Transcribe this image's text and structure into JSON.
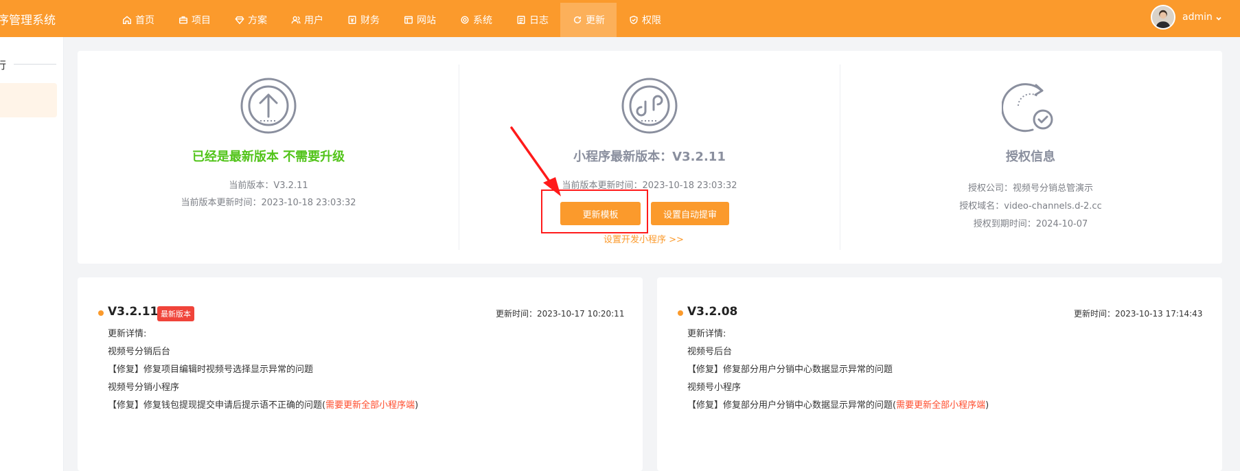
{
  "header": {
    "brand": "序管理系统",
    "nav": [
      {
        "label": "首页",
        "icon": "home-icon"
      },
      {
        "label": "项目",
        "icon": "briefcase-icon"
      },
      {
        "label": "方案",
        "icon": "diamond-icon"
      },
      {
        "label": "用户",
        "icon": "users-icon"
      },
      {
        "label": "财务",
        "icon": "finance-icon"
      },
      {
        "label": "网站",
        "icon": "window-icon"
      },
      {
        "label": "系统",
        "icon": "gear-icon"
      },
      {
        "label": "日志",
        "icon": "log-icon"
      },
      {
        "label": "更新",
        "icon": "refresh-icon",
        "active": true
      },
      {
        "label": "权限",
        "icon": "shield-icon"
      }
    ],
    "user": "admin"
  },
  "sidebar": {
    "title": "行"
  },
  "status": {
    "upgrade": {
      "title": "已经是最新版本 不需要升级",
      "current_version": "当前版本：V3.2.11",
      "update_time": "当前版本更新时间：2023-10-18 23:03:32"
    },
    "miniprogram": {
      "title": "小程序最新版本：V3.2.11",
      "update_time": "当前版本更新时间：2023-10-18 23:03:32",
      "btn_update": "更新模板",
      "btn_auto": "设置自动提审",
      "link_dev": "设置开发小程序 >>"
    },
    "license": {
      "title": "授权信息",
      "company": "授权公司：视频号分销总管演示",
      "domain": "授权域名：video-channels.d-2.cc",
      "expire": "授权到期时间：2024-10-07"
    }
  },
  "releases": [
    {
      "version": "V3.2.11",
      "badge": "最新版本",
      "time": "更新时间：2023-10-17 10:20:11",
      "lines": [
        "更新详情:",
        "视频号分销后台",
        "【修复】修复项目编辑时视频号选择显示异常的问题",
        "视频号分销小程序",
        "【修复】修复钱包提现提交申请后提示语不正确的问题("
      ],
      "note": "需要更新全部小程序端",
      "tail": ")"
    },
    {
      "version": "V3.2.08",
      "badge": "",
      "time": "更新时间：2023-10-13 17:14:43",
      "lines": [
        "更新详情:",
        "视频号后台",
        "【修复】修复部分用户分销中心数据显示异常的问题",
        "视频号小程序",
        "【修复】修复部分用户分销中心数据显示异常的问题("
      ],
      "note": "需要更新全部小程序端",
      "tail": ")"
    }
  ],
  "colors": {
    "accent": "#fb9a2c",
    "success": "#52c41a",
    "title_gray": "#8a8f9e",
    "badge": "#f0443a",
    "highlight": "#ff4b2b"
  }
}
